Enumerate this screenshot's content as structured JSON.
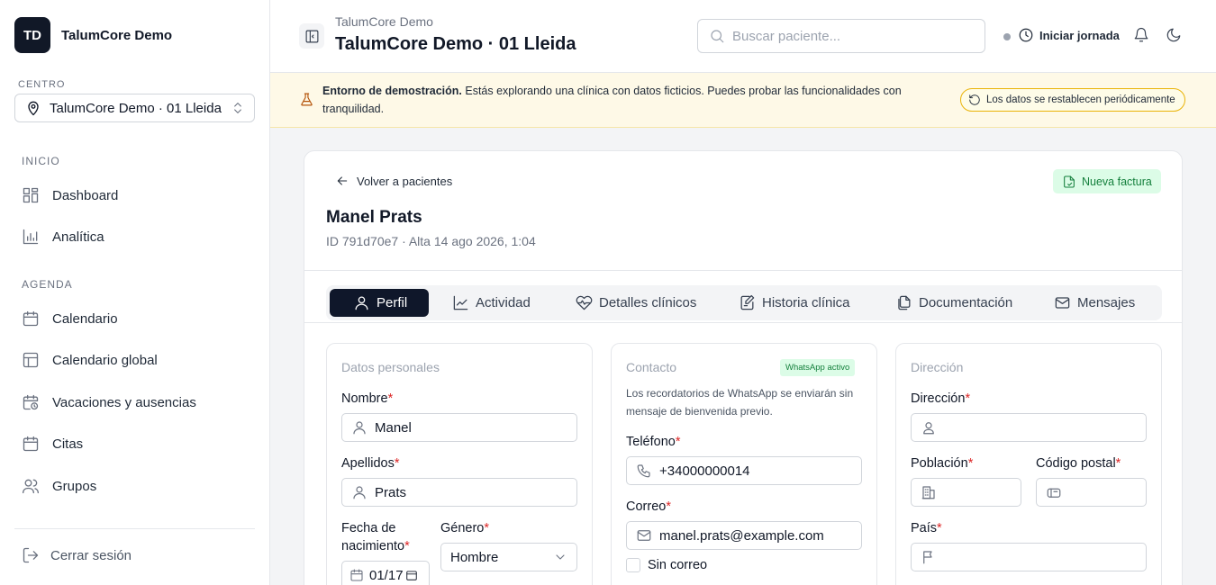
{
  "sidebar": {
    "logo_initials": "TD",
    "brand": "TalumCore Demo",
    "centro_label": "CENTRO",
    "centro_value": "TalumCore Demo · 01 Lleida",
    "sections": [
      {
        "label": "INICIO"
      },
      {
        "label": "AGENDA"
      }
    ],
    "items": [
      {
        "label": "Dashboard",
        "icon": "dashboard-icon"
      },
      {
        "label": "Analítica",
        "icon": "chart-icon"
      },
      {
        "label": "Calendario",
        "icon": "calendar-icon"
      },
      {
        "label": "Calendario global",
        "icon": "layout-icon"
      },
      {
        "label": "Vacaciones y ausencias",
        "icon": "calendar-clock-icon"
      },
      {
        "label": "Citas",
        "icon": "calendar-icon"
      },
      {
        "label": "Grupos",
        "icon": "users-icon"
      }
    ],
    "logout": "Cerrar sesión"
  },
  "header": {
    "subtitle": "TalumCore Demo",
    "title": "TalumCore Demo · 01 Lleida",
    "search_placeholder": "Buscar paciente...",
    "jornada": "Iniciar jornada"
  },
  "banner": {
    "strong": "Entorno de demostración.",
    "text": " Estás explorando una clínica con datos ficticios. Puedes probar las funcionalidades con tranquilidad.",
    "pill": "Los datos se restablecen periódicamente",
    "accent": "#eab308"
  },
  "patient": {
    "back": "Volver a pacientes",
    "invoice": "Nueva factura",
    "name": "Manel Prats",
    "meta": "ID 791d70e7 · Alta 14 ago 2026, 1:04"
  },
  "tabs": [
    {
      "label": "Perfil"
    },
    {
      "label": "Actividad"
    },
    {
      "label": "Detalles clínicos"
    },
    {
      "label": "Historia clínica"
    },
    {
      "label": "Documentación"
    },
    {
      "label": "Mensajes"
    }
  ],
  "personal": {
    "title": "Datos personales",
    "nombre_label": "Nombre",
    "nombre": "Manel",
    "apellidos_label": "Apellidos",
    "apellidos": "Prats",
    "fecha_label": "Fecha de nacimiento",
    "fecha": "01/17",
    "genero_label": "Género",
    "genero": "Hombre"
  },
  "contacto": {
    "title": "Contacto",
    "badge": "WhatsApp activo",
    "note": "Los recordatorios de WhatsApp se enviarán sin mensaje de bienvenida previo.",
    "telefono_label": "Teléfono",
    "telefono": "+34000000014",
    "correo_label": "Correo",
    "correo": "manel.prats@example.com",
    "sin_correo": "Sin correo"
  },
  "direccion": {
    "title": "Dirección",
    "direccion_label": "Dirección",
    "direccion": "",
    "poblacion_label": "Población",
    "poblacion": "",
    "cp_label": "Código postal",
    "cp": "",
    "pais_label": "País",
    "pais": ""
  },
  "required_mark": "*"
}
